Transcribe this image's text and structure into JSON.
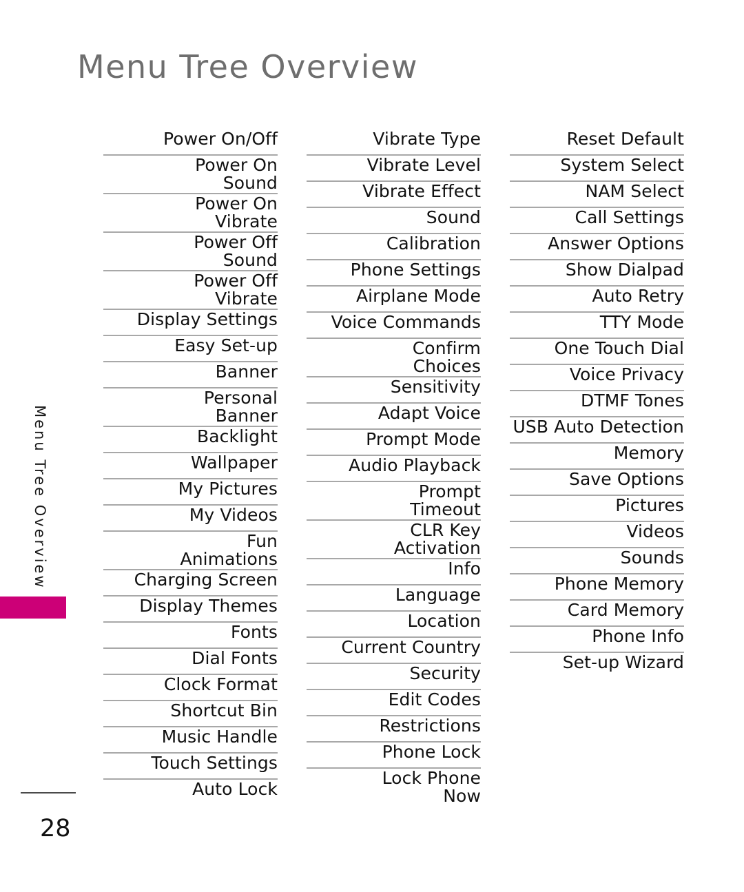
{
  "page": {
    "title": "Menu Tree Overview",
    "side_rail_label": "Menu Tree Overview",
    "page_number": "28",
    "accent_color": "#CC0077",
    "title_color": "#6E6E6E",
    "rule_color": "#A8A8A8",
    "text_color": "#111111"
  },
  "menu_tree": {
    "columns": [
      {
        "id": "column-1",
        "items": [
          {
            "label": "Power On/Off",
            "level": 1,
            "lines": 1
          },
          {
            "label": "Power On\nSound",
            "level": 2,
            "lines": 2
          },
          {
            "label": "Power On\nVibrate",
            "level": 2,
            "lines": 2
          },
          {
            "label": "Power Off\nSound",
            "level": 2,
            "lines": 2
          },
          {
            "label": "Power Off\nVibrate",
            "level": 2,
            "lines": 2
          },
          {
            "label": "Display Settings",
            "level": 0,
            "lines": 1
          },
          {
            "label": "Easy Set-up",
            "level": 1,
            "lines": 1
          },
          {
            "label": "Banner",
            "level": 1,
            "lines": 1
          },
          {
            "label": "Personal Banner",
            "level": 2,
            "lines": 1
          },
          {
            "label": "Backlight",
            "level": 1,
            "lines": 1
          },
          {
            "label": "Wallpaper",
            "level": 1,
            "lines": 1
          },
          {
            "label": "My Pictures",
            "level": 2,
            "lines": 1
          },
          {
            "label": "My Videos",
            "level": 2,
            "lines": 1
          },
          {
            "label": "Fun Animations",
            "level": 2,
            "lines": 1
          },
          {
            "label": "Charging Screen",
            "level": 1,
            "lines": 1
          },
          {
            "label": "Display Themes",
            "level": 1,
            "lines": 1
          },
          {
            "label": "Fonts",
            "level": 1,
            "lines": 1
          },
          {
            "label": "Dial Fonts",
            "level": 1,
            "lines": 1
          },
          {
            "label": "Clock Format",
            "level": 1,
            "lines": 1
          },
          {
            "label": "Shortcut Bin",
            "level": 1,
            "lines": 1
          },
          {
            "label": "Music Handle",
            "level": 1,
            "lines": 1
          },
          {
            "label": "Touch Settings",
            "level": 0,
            "lines": 1
          },
          {
            "label": "Auto Lock",
            "level": 1,
            "lines": 1
          }
        ]
      },
      {
        "id": "column-2",
        "items": [
          {
            "label": "Vibrate Type",
            "level": 1,
            "lines": 1
          },
          {
            "label": "Vibrate Level",
            "level": 1,
            "lines": 1
          },
          {
            "label": "Vibrate Effect",
            "level": 1,
            "lines": 1
          },
          {
            "label": "Sound",
            "level": 1,
            "lines": 1
          },
          {
            "label": "Calibration",
            "level": 1,
            "lines": 1
          },
          {
            "label": "Phone Settings",
            "level": 0,
            "lines": 1
          },
          {
            "label": "Airplane Mode",
            "level": 1,
            "lines": 1
          },
          {
            "label": "Voice Commands",
            "level": 1,
            "lines": 1
          },
          {
            "label": "Confirm Choices",
            "level": 2,
            "lines": 1
          },
          {
            "label": "Sensitivity",
            "level": 2,
            "lines": 1
          },
          {
            "label": "Adapt Voice",
            "level": 2,
            "lines": 1
          },
          {
            "label": "Prompt Mode",
            "level": 2,
            "lines": 1
          },
          {
            "label": "Audio Playback",
            "level": 2,
            "lines": 1
          },
          {
            "label": "Prompt Timeout",
            "level": 2,
            "lines": 1
          },
          {
            "label": "CLR Key\nActivation",
            "level": 2,
            "lines": 2
          },
          {
            "label": "Info",
            "level": 2,
            "lines": 1
          },
          {
            "label": "Language",
            "level": 1,
            "lines": 1
          },
          {
            "label": "Location",
            "level": 1,
            "lines": 1
          },
          {
            "label": "Current Country",
            "level": 1,
            "lines": 1
          },
          {
            "label": "Security",
            "level": 1,
            "lines": 1
          },
          {
            "label": "Edit Codes",
            "level": 2,
            "lines": 1
          },
          {
            "label": "Restrictions",
            "level": 2,
            "lines": 1
          },
          {
            "label": "Phone Lock",
            "level": 2,
            "lines": 1
          },
          {
            "label": "Lock Phone\nNow",
            "level": 2,
            "lines": 2
          }
        ]
      },
      {
        "id": "column-3",
        "items": [
          {
            "label": "Reset Default",
            "level": 2,
            "lines": 1
          },
          {
            "label": "System Select",
            "level": 1,
            "lines": 1
          },
          {
            "label": "NAM Select",
            "level": 1,
            "lines": 1
          },
          {
            "label": "Call Settings",
            "level": 0,
            "lines": 1
          },
          {
            "label": "Answer Options",
            "level": 1,
            "lines": 1
          },
          {
            "label": "Show Dialpad",
            "level": 1,
            "lines": 1
          },
          {
            "label": "Auto Retry",
            "level": 1,
            "lines": 1
          },
          {
            "label": "TTY Mode",
            "level": 1,
            "lines": 1
          },
          {
            "label": "One Touch Dial",
            "level": 1,
            "lines": 1
          },
          {
            "label": "Voice Privacy",
            "level": 1,
            "lines": 1
          },
          {
            "label": "DTMF Tones",
            "level": 1,
            "lines": 1
          },
          {
            "label": "USB Auto Detection",
            "level": 0,
            "lines": 1
          },
          {
            "label": "Memory",
            "level": 0,
            "lines": 1
          },
          {
            "label": "Save Options",
            "level": 1,
            "lines": 1
          },
          {
            "label": "Pictures",
            "level": 2,
            "lines": 1
          },
          {
            "label": "Videos",
            "level": 2,
            "lines": 1
          },
          {
            "label": "Sounds",
            "level": 2,
            "lines": 1
          },
          {
            "label": "Phone Memory",
            "level": 1,
            "lines": 1
          },
          {
            "label": "Card Memory",
            "level": 1,
            "lines": 1
          },
          {
            "label": "Phone Info",
            "level": 0,
            "lines": 1
          },
          {
            "label": "Set-up Wizard",
            "level": 0,
            "lines": 1
          }
        ]
      }
    ]
  }
}
